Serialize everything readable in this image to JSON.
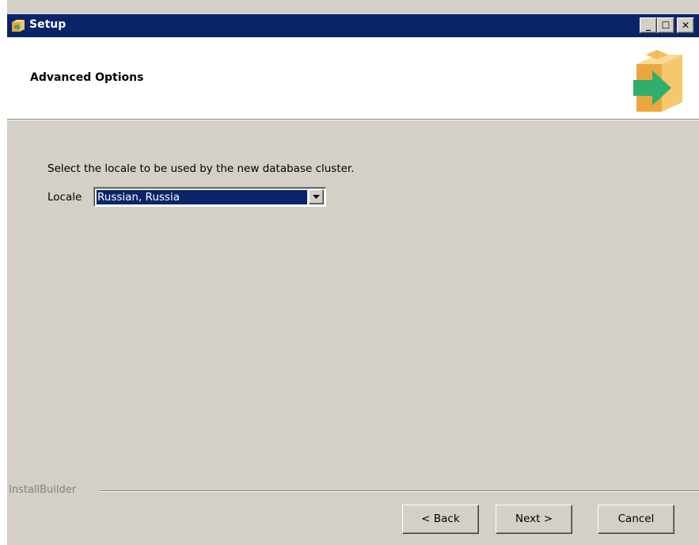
{
  "window": {
    "title": "Setup",
    "minimize_glyph": "_",
    "maximize_glyph": "☐",
    "close_glyph": "✕"
  },
  "header": {
    "title": "Advanced Options",
    "icon": "installer-box-arrow-icon"
  },
  "content": {
    "instruction": "Select the locale to be used by the new database cluster.",
    "locale_label": "Locale",
    "locale_value": "Russian, Russia"
  },
  "footer": {
    "brand": "InstallBuilder",
    "back_label": "< Back",
    "next_label": "Next >",
    "cancel_label": "Cancel"
  },
  "colors": {
    "titlebar": "#0a246a",
    "face": "#d4d0c8",
    "selection": "#0a246a"
  }
}
